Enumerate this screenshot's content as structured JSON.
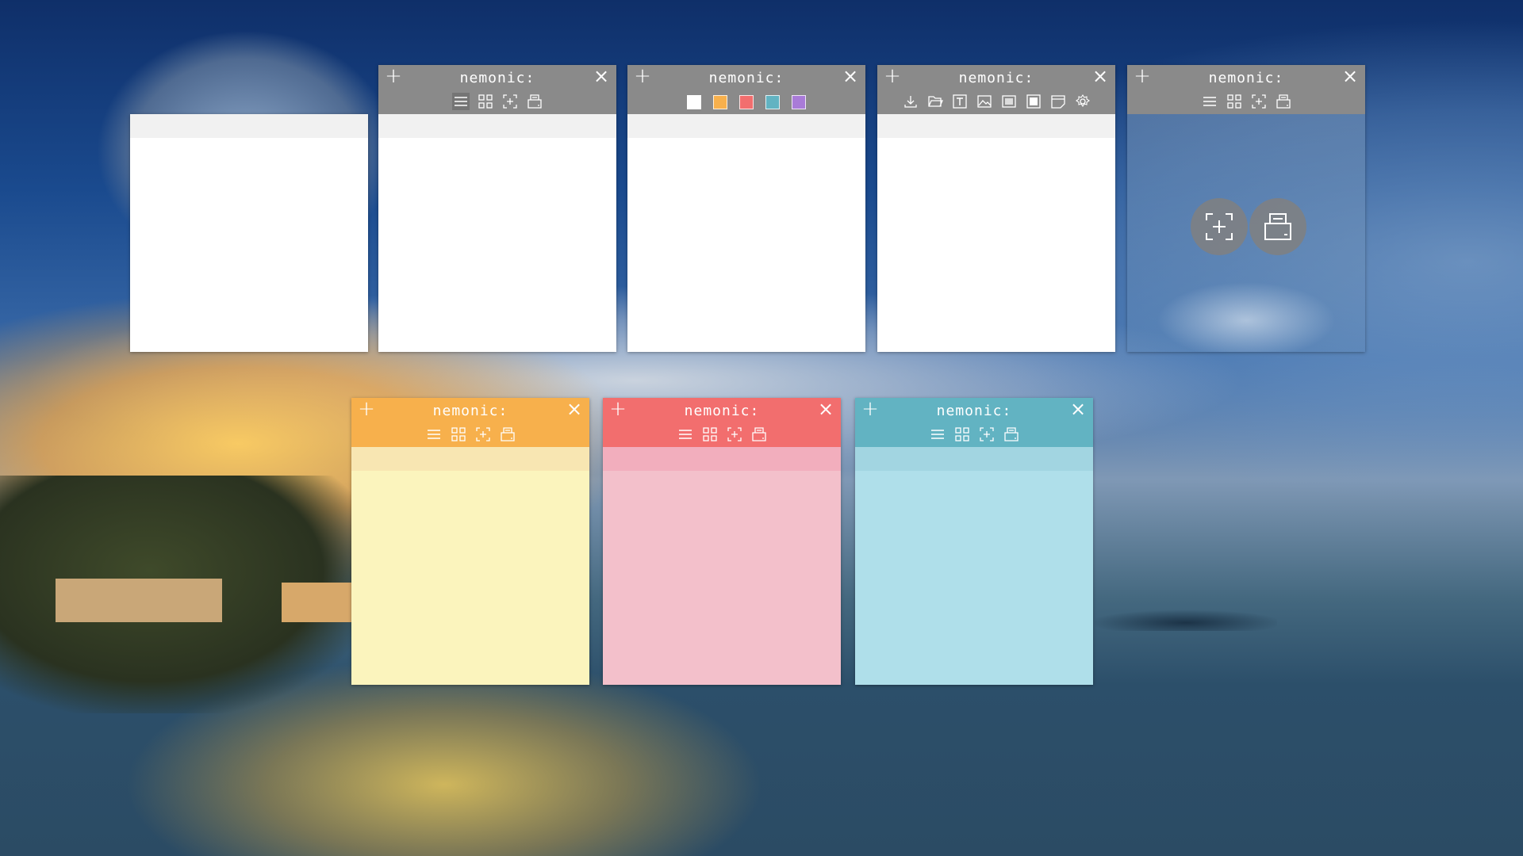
{
  "app": {
    "title": "nemonic:"
  },
  "icons": {
    "plus": "+",
    "close": "×",
    "menu": "menu-icon",
    "grid": "grid-icon",
    "capture": "capture-icon",
    "print": "print-icon"
  },
  "colors": {
    "white": "#ffffff",
    "orange": "#f7b04c",
    "red": "#f26e6e",
    "teal": "#62b3c2",
    "purple": "#a97bd8"
  }
}
